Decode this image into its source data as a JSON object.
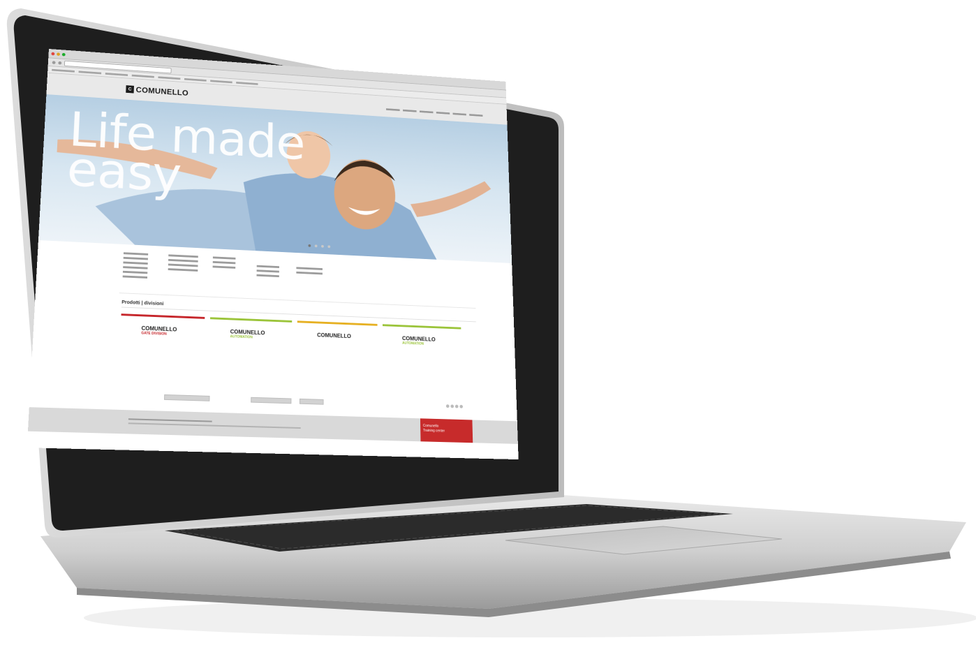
{
  "site": {
    "logo_text": "COMUNELLO",
    "logo_mark": "C"
  },
  "hero": {
    "line1": "Life made",
    "line2": "easy"
  },
  "products": {
    "title": "Prodotti | divisioni",
    "divisions": [
      {
        "brand": "COMUNELLO",
        "sub": "GATE DIVISION",
        "bar_color": "#c6262b",
        "sub_color": "#c6262b"
      },
      {
        "brand": "COMUNELLO",
        "sub": "AUTOMATION",
        "bar_color": "#9bc43a",
        "sub_color": "#9bc43a"
      },
      {
        "brand": "COMUNELLO",
        "sub": "",
        "bar_color": "#e6b022",
        "sub_color": "#e6b022"
      },
      {
        "brand": "COMUNELLO",
        "sub": "AUTOMATION",
        "bar_color": "#9bc43a",
        "sub_color": "#9bc43a"
      }
    ]
  },
  "footer": {
    "training_line1": "Comunello",
    "training_line2": "Training center"
  },
  "colors": {
    "brand_red": "#c72b2b",
    "laptop_silver": "#c9c9c9",
    "bezel": "#1e1e1e"
  }
}
